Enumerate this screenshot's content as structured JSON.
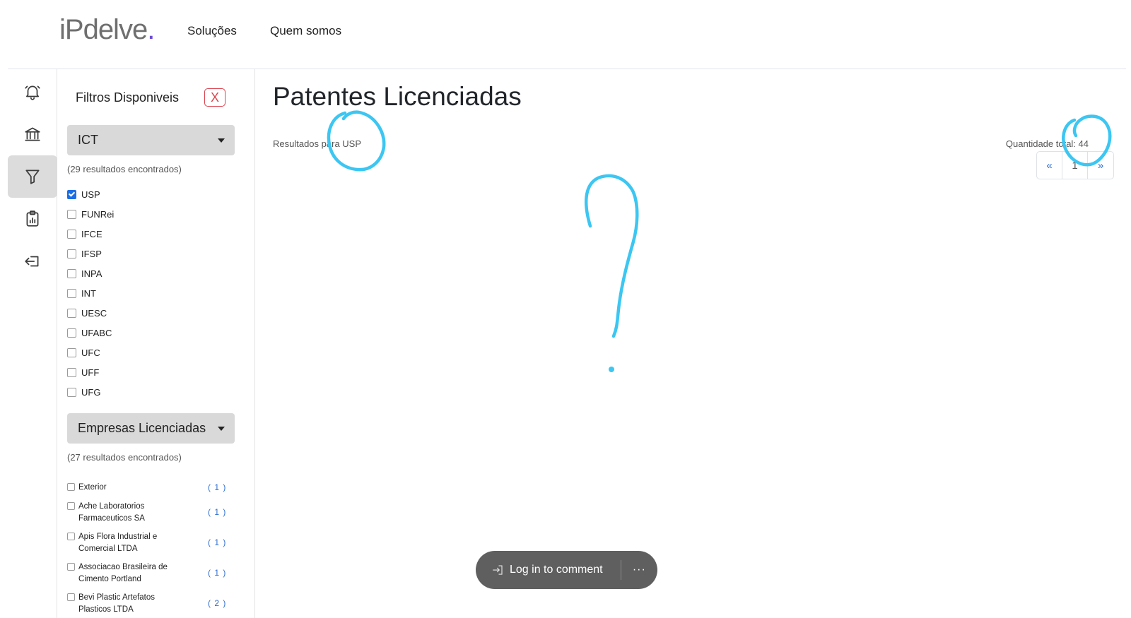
{
  "brand": {
    "logo_main": "iPdelve",
    "logo_dot": "."
  },
  "nav": {
    "solucoes": "Soluções",
    "quem_somos": "Quem somos"
  },
  "rail": {
    "items": [
      {
        "icon": "bell-icon"
      },
      {
        "icon": "bank-icon"
      },
      {
        "icon": "filter-icon",
        "active": true
      },
      {
        "icon": "clipboard-chart-icon"
      },
      {
        "icon": "logout-icon"
      }
    ]
  },
  "filters": {
    "title": "Filtros Disponiveis",
    "close_label": "X",
    "ict": {
      "label": "ICT",
      "results": "(29 resultados encontrados)",
      "options": [
        {
          "label": "USP",
          "checked": true
        },
        {
          "label": "FUNRei",
          "checked": false
        },
        {
          "label": "IFCE",
          "checked": false
        },
        {
          "label": "IFSP",
          "checked": false
        },
        {
          "label": "INPA",
          "checked": false
        },
        {
          "label": "INT",
          "checked": false
        },
        {
          "label": "UESC",
          "checked": false
        },
        {
          "label": "UFABC",
          "checked": false
        },
        {
          "label": "UFC",
          "checked": false
        },
        {
          "label": "UFF",
          "checked": false
        },
        {
          "label": "UFG",
          "checked": false
        }
      ]
    },
    "empresas": {
      "label": "Empresas Licenciadas",
      "results": "(27 resultados encontrados)",
      "options": [
        {
          "label": "Exterior",
          "count": "( 1 )"
        },
        {
          "label": "Ache Laboratorios Farmaceuticos SA",
          "count": "( 1 )"
        },
        {
          "label": "Apis Flora Industrial e Comercial LTDA",
          "count": "( 1 )"
        },
        {
          "label": "Associacao Brasileira de Cimento Portland",
          "count": "( 1 )"
        },
        {
          "label": "Bevi Plastic Artefatos Plasticos LTDA",
          "count": "( 2 )"
        }
      ]
    }
  },
  "main": {
    "title": "Patentes Licenciadas",
    "results_for": "Resultados para USP",
    "total": "Quantidade total: 44",
    "pagination": {
      "first": "«",
      "current": "1",
      "last": "»"
    }
  },
  "comment": {
    "login": "Log in to comment",
    "more": "···"
  },
  "colors": {
    "annotation": "#3cc6f2",
    "accent": "#2f6fd1",
    "close": "#d9434e"
  }
}
